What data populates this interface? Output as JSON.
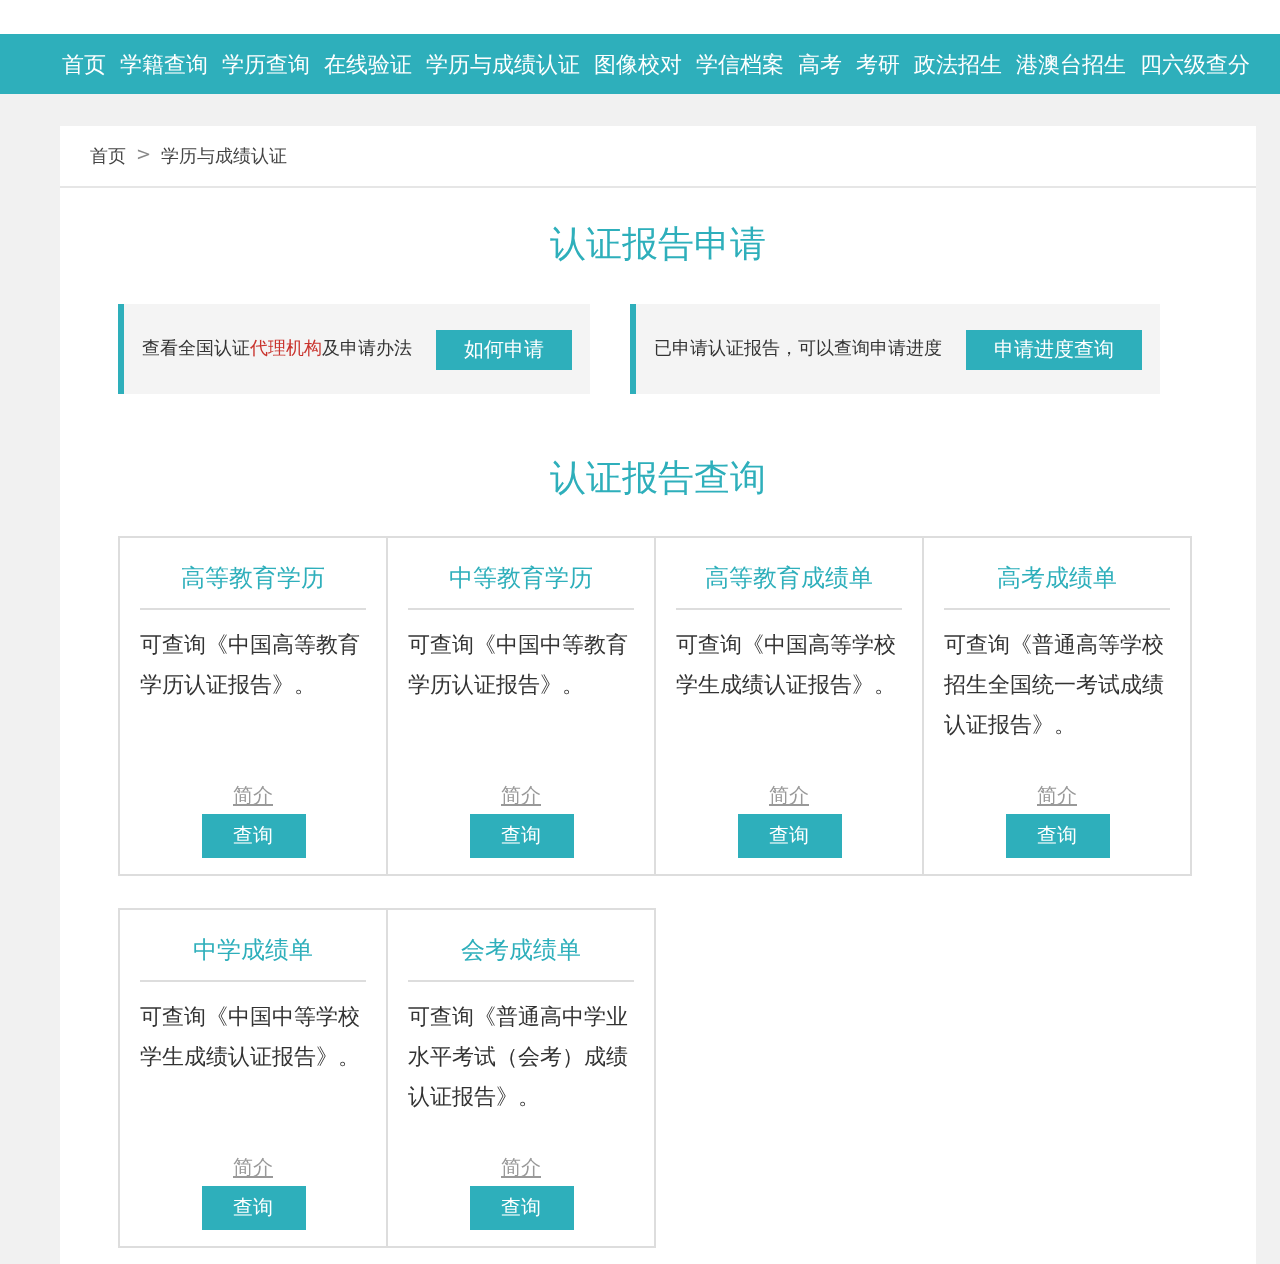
{
  "nav": [
    {
      "label": "首页"
    },
    {
      "label": "学籍查询"
    },
    {
      "label": "学历查询"
    },
    {
      "label": "在线验证"
    },
    {
      "label": "学历与成绩认证"
    },
    {
      "label": "图像校对"
    },
    {
      "label": "学信档案"
    },
    {
      "label": "高考"
    },
    {
      "label": "考研"
    },
    {
      "label": "政法招生"
    },
    {
      "label": "港澳台招生"
    },
    {
      "label": "四六级查分"
    }
  ],
  "breadcrumb": {
    "items": [
      "首页",
      "学历与成绩认证"
    ],
    "separator": ">"
  },
  "apply": {
    "title": "认证报告申请",
    "banners": [
      {
        "parts": [
          {
            "kind": "text",
            "text": "查看全国认证"
          },
          {
            "kind": "link",
            "text": "代理机构"
          },
          {
            "kind": "text",
            "text": "及申请办法"
          }
        ],
        "button": "如何申请"
      },
      {
        "parts": [
          {
            "kind": "text",
            "text": "已申请认证报告，可以查询申请进度"
          }
        ],
        "button": "申请进度查询"
      }
    ]
  },
  "query": {
    "title": "认证报告查询",
    "cards": [
      {
        "title": "高等教育学历",
        "description": "可查询《中国高等教育学历认证报告》。",
        "intro": "简介",
        "button": "查询"
      },
      {
        "title": "中等教育学历",
        "description": "可查询《中国中等教育学历认证报告》。",
        "intro": "简介",
        "button": "查询"
      },
      {
        "title": "高等教育成绩单",
        "description": "可查询《中国高等学校学生成绩认证报告》。",
        "intro": "简介",
        "button": "查询"
      },
      {
        "title": "高考成绩单",
        "description": "可查询《普通高等学校招生全国统一考试成绩认证报告》。",
        "intro": "简介",
        "button": "查询"
      },
      {
        "title": "中学成绩单",
        "description": "可查询《中国中等学校学生成绩认证报告》。",
        "intro": "简介",
        "button": "查询"
      },
      {
        "title": "会考成绩单",
        "description": "可查询《普通高中学业水平考试（会考）成绩认证报告》。",
        "intro": "简介",
        "button": "查询"
      }
    ]
  }
}
